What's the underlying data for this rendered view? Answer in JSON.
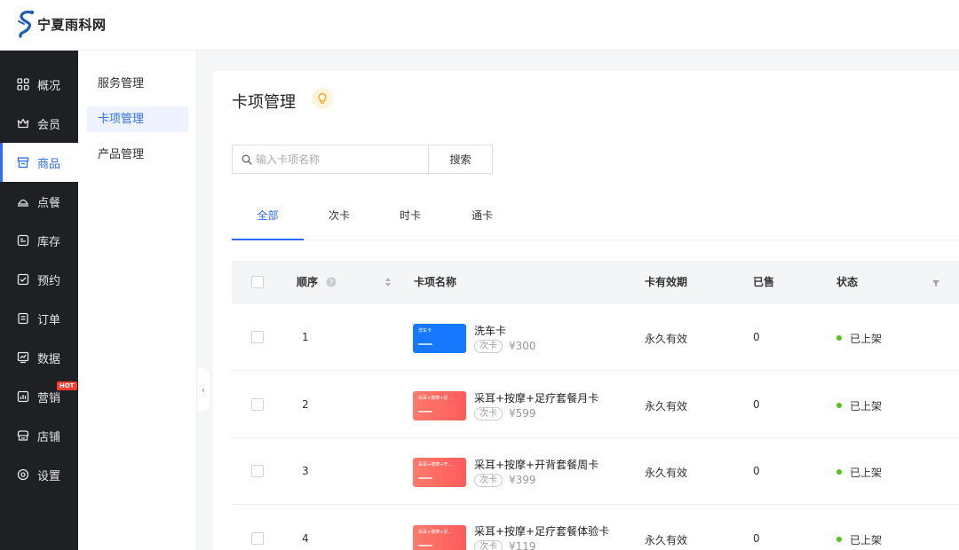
{
  "brand": {
    "name": "宁夏雨科网"
  },
  "sidebar": {
    "items": [
      {
        "label": "概况",
        "icon": "grid-icon"
      },
      {
        "label": "会员",
        "icon": "crown-icon"
      },
      {
        "label": "商品",
        "icon": "store-icon",
        "active": true
      },
      {
        "label": "点餐",
        "icon": "dish-icon"
      },
      {
        "label": "库存",
        "icon": "inventory-icon"
      },
      {
        "label": "预约",
        "icon": "calendar-check-icon"
      },
      {
        "label": "订单",
        "icon": "order-icon"
      },
      {
        "label": "数据",
        "icon": "chart-icon"
      },
      {
        "label": "营销",
        "icon": "marketing-icon",
        "badge": "HOT"
      },
      {
        "label": "店铺",
        "icon": "shop-icon"
      },
      {
        "label": "设置",
        "icon": "settings-icon"
      }
    ]
  },
  "subnav": {
    "items": [
      {
        "label": "服务管理"
      },
      {
        "label": "卡项管理",
        "active": true
      },
      {
        "label": "产品管理"
      }
    ]
  },
  "page": {
    "title": "卡项管理"
  },
  "search": {
    "placeholder": "输入卡项名称",
    "button_label": "搜索"
  },
  "tabs": [
    {
      "label": "全部",
      "active": true
    },
    {
      "label": "次卡"
    },
    {
      "label": "时卡"
    },
    {
      "label": "通卡"
    }
  ],
  "table": {
    "headers": {
      "order": "顺序",
      "name": "卡项名称",
      "validity": "卡有效期",
      "sold": "已售",
      "status": "状态"
    },
    "rows": [
      {
        "order": "1",
        "name": "洗车卡",
        "thumb_text": "洗车卡",
        "type": "次卡",
        "price": "¥300",
        "validity": "永久有效",
        "sold": "0",
        "status": "已上架",
        "thumb_color": "#1677ff"
      },
      {
        "order": "2",
        "name": "采耳+按摩+足疗套餐月卡",
        "thumb_text": "采耳+按摩+足...",
        "type": "次卡",
        "price": "¥599",
        "validity": "永久有效",
        "sold": "0",
        "status": "已上架",
        "thumb_color": "#ff6b5e"
      },
      {
        "order": "3",
        "name": "采耳+按摩+开背套餐周卡",
        "thumb_text": "采耳+按摩+开...",
        "type": "次卡",
        "price": "¥399",
        "validity": "永久有效",
        "sold": "0",
        "status": "已上架",
        "thumb_color": "#ff6b5e"
      },
      {
        "order": "4",
        "name": "采耳+按摩+足疗套餐体验卡",
        "thumb_text": "采耳+按摩+足...",
        "type": "次卡",
        "price": "¥119",
        "validity": "永久有效",
        "sold": "0",
        "status": "已上架",
        "thumb_color": "#ff6b5e"
      }
    ]
  },
  "colors": {
    "accent": "#2f6bff",
    "sidebar_bg": "#1f2023",
    "status_green": "#52c41a"
  }
}
